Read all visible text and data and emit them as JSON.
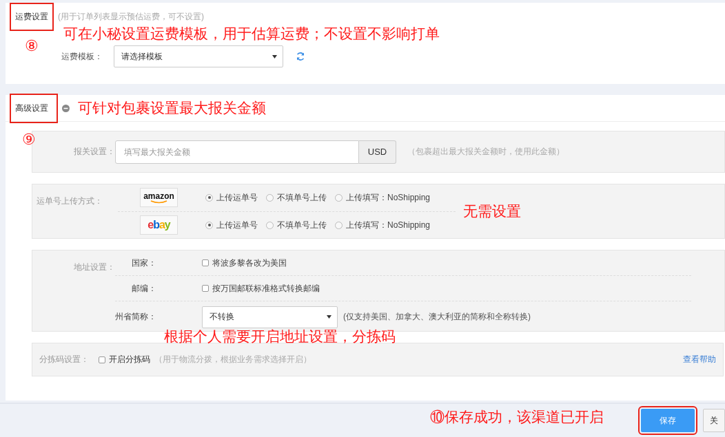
{
  "shipping": {
    "title": "运费设置",
    "note": "(用于订单列表显示预估运费，可不设置)",
    "template_label": "运费模板：",
    "template_value": "请选择模板"
  },
  "advanced": {
    "title": "高级设置",
    "customs": {
      "label": "报关设置：",
      "placeholder": "填写最大报关金额",
      "unit": "USD",
      "note": "（包裹超出最大报关金额时，使用此金额）"
    },
    "upload": {
      "label": "运单号上传方式：",
      "platforms": [
        {
          "kind": "amazon",
          "logo": "amazon",
          "options": [
            {
              "label": "上传运单号",
              "selected": true
            },
            {
              "label": "不填单号上传",
              "selected": false
            },
            {
              "label": "上传填写：NoShipping",
              "selected": false
            }
          ]
        },
        {
          "kind": "ebay",
          "logo": "ebay",
          "options": [
            {
              "label": "上传运单号",
              "selected": true
            },
            {
              "label": "不填单号上传",
              "selected": false
            },
            {
              "label": "上传填写：NoShipping",
              "selected": false
            }
          ]
        }
      ]
    },
    "address": {
      "label": "地址设置：",
      "rows": [
        {
          "kind": "checkbox",
          "label": "国家：",
          "option": "将波多黎各改为美国",
          "checked": false
        },
        {
          "kind": "checkbox",
          "label": "邮编：",
          "option": "按万国邮联标准格式转换邮编",
          "checked": false
        },
        {
          "kind": "select",
          "label": "州省简称：",
          "value": "不转换",
          "note": "(仅支持美国、加拿大、澳大利亚的简称和全称转换)"
        }
      ]
    },
    "sorting": {
      "label": "分拣码设置：",
      "option": "开启分拣码",
      "checked": false,
      "note": "（用于物流分拨，根据业务需求选择开启）",
      "help_link": "查看帮助"
    }
  },
  "footer": {
    "buttons": [
      {
        "label": "保存",
        "kind": "primary"
      },
      {
        "label": "关",
        "kind": "default"
      }
    ]
  },
  "annotations": [
    {
      "kind": "text",
      "text": "可在小秘设置运费模板，用于估算运费；不设置不影响打单"
    },
    {
      "kind": "number",
      "text": "⑧"
    },
    {
      "kind": "text",
      "text": "可针对包裹设置最大报关金额"
    },
    {
      "kind": "number",
      "text": "⑨"
    },
    {
      "kind": "text",
      "text": "无需设置"
    },
    {
      "kind": "text",
      "text": "根据个人需要开启地址设置，分拣码"
    },
    {
      "kind": "text",
      "text": "⑩保存成功，该渠道已开启"
    }
  ]
}
